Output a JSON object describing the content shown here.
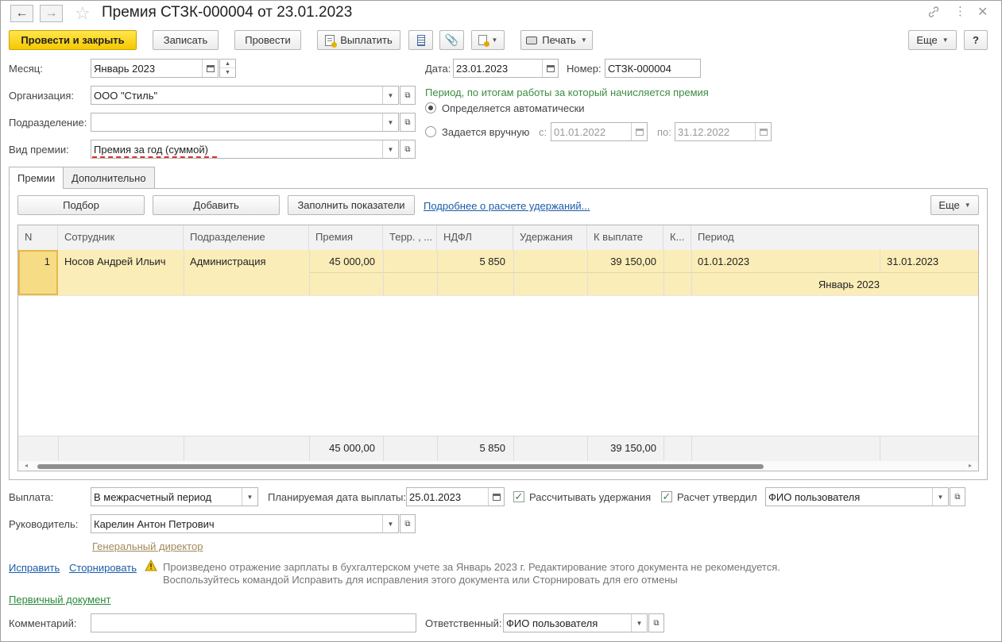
{
  "window": {
    "title": "Премия СТЗК-000004 от 23.01.2023",
    "nav_back": "←",
    "nav_forward": "→"
  },
  "toolbar": {
    "post_close": "Провести и закрыть",
    "save": "Записать",
    "post": "Провести",
    "pay": "Выплатить",
    "print": "Печать",
    "more": "Еще",
    "help": "?"
  },
  "header": {
    "month_label": "Месяц:",
    "month_value": "Январь 2023",
    "org_label": "Организация:",
    "org_value": "ООО \"Стиль\"",
    "dept_label": "Подразделение:",
    "dept_value": "",
    "bonus_type_label": "Вид премии:",
    "bonus_type_value": "Премия за год (суммой)",
    "date_label": "Дата:",
    "date_value": "23.01.2023",
    "number_label": "Номер:",
    "number_value": "СТЗК-000004",
    "period_caption": "Период, по итогам работы за который начисляется премия",
    "radio_auto": "Определяется автоматически",
    "radio_manual": "Задается вручную",
    "from_label": "с:",
    "from_value": "01.01.2022",
    "to_label": "по:",
    "to_value": "31.12.2022"
  },
  "tabs": [
    {
      "label": "Премии",
      "active": true
    },
    {
      "label": "Дополнительно",
      "active": false
    }
  ],
  "tab_toolbar": {
    "pick": "Подбор",
    "add": "Добавить",
    "fill": "Заполнить показатели",
    "details_link": "Подробнее о расчете удержаний...",
    "more": "Еще"
  },
  "table": {
    "columns": [
      "N",
      "Сотрудник",
      "Подразделение",
      "Премия",
      "Терр. , ...",
      "НДФЛ",
      "Удержания",
      "К выплате",
      "К...",
      "Период"
    ],
    "rows": [
      {
        "n": "1",
        "employee": "Носов Андрей Ильич",
        "department": "Администрация",
        "bonus": "45 000,00",
        "terr": "",
        "ndfl": "5 850",
        "deductions": "",
        "to_pay": "39 150,00",
        "k": "",
        "period_from": "01.01.2023",
        "period_to": "31.01.2023",
        "period_month": "Январь 2023"
      }
    ],
    "totals": {
      "bonus": "45 000,00",
      "ndfl": "5 850",
      "to_pay": "39 150,00"
    }
  },
  "footer": {
    "payout_label": "Выплата:",
    "payout_value": "В межрасчетный период",
    "plan_date_label": "Планируемая дата выплаты:",
    "plan_date_value": "25.01.2023",
    "calc_deductions": "Рассчитывать удержания",
    "calc_approved": "Расчет утвердил",
    "approver_value": "ФИО пользователя",
    "manager_label": "Руководитель:",
    "manager_value": "Карелин Антон Петрович",
    "manager_position": "Генеральный директор",
    "fix_link": "Исправить",
    "storno_link": "Сторнировать",
    "warning_line1": "Произведено отражение зарплаты в бухгалтерском учете за Январь 2023 г. Редактирование этого документа не рекомендуется.",
    "warning_line2": "Воспользуйтесь командой Исправить для исправления этого документа или Сторнировать для его отмены",
    "primary_doc_link": "Первичный документ",
    "comment_label": "Комментарий:",
    "comment_value": "",
    "responsible_label": "Ответственный:",
    "responsible_value": "ФИО пользователя"
  },
  "colors": {
    "primary_button": "#f6c800",
    "selected_row": "#fbedb8",
    "green_text": "#3d8c40",
    "link": "#1b5ca8"
  }
}
